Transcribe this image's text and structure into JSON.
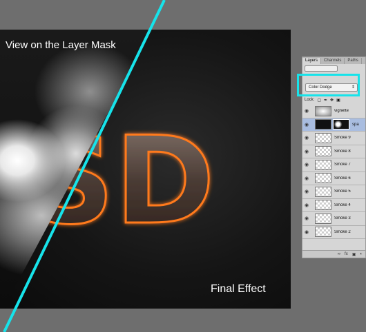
{
  "artwork": {
    "mask_title": "View on the Layer Mask",
    "final_label": "Final Effect",
    "fx_text": "SD"
  },
  "layers_panel": {
    "tabs": [
      {
        "label": "Layers"
      },
      {
        "label": "Channels"
      },
      {
        "label": "Paths"
      }
    ],
    "blend_mode": "Color Dodge",
    "lock_label": "Lock:",
    "layers": [
      {
        "name": "vignette",
        "thumb": "vignette",
        "visible": true,
        "selected": false
      },
      {
        "name": "spa",
        "thumb": "mask",
        "visible": true,
        "selected": true
      },
      {
        "name": "Smoke 9",
        "thumb": "transparent",
        "visible": true,
        "selected": false
      },
      {
        "name": "Smoke 8",
        "thumb": "transparent",
        "visible": true,
        "selected": false
      },
      {
        "name": "Smoke 7",
        "thumb": "transparent",
        "visible": true,
        "selected": false
      },
      {
        "name": "Smoke 6",
        "thumb": "transparent",
        "visible": true,
        "selected": false
      },
      {
        "name": "Smoke 5",
        "thumb": "transparent",
        "visible": true,
        "selected": false
      },
      {
        "name": "Smoke 4",
        "thumb": "transparent",
        "visible": true,
        "selected": false
      },
      {
        "name": "Smoke 3",
        "thumb": "transparent",
        "visible": true,
        "selected": false
      },
      {
        "name": "Smoke 2",
        "thumb": "transparent",
        "visible": true,
        "selected": false
      }
    ],
    "footer_fx": "fx",
    "icons": [
      "link-icon",
      "fx-icon",
      "mask-icon",
      "adjustment-icon"
    ]
  },
  "colors": {
    "highlight": "#17e3ea",
    "fire": "#ff7a1a",
    "rock": "#6b5a52"
  }
}
